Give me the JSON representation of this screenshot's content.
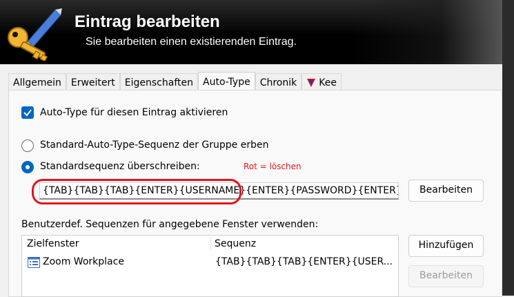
{
  "header": {
    "title": "Eintrag bearbeiten",
    "subtitle": "Sie bearbeiten einen existierenden Eintrag."
  },
  "tabs": [
    {
      "label": "Allgemein",
      "active": false
    },
    {
      "label": "Erweitert",
      "active": false
    },
    {
      "label": "Eigenschaften",
      "active": false
    },
    {
      "label": "Auto-Type",
      "active": true
    },
    {
      "label": "Chronik",
      "active": false
    },
    {
      "label": "Kee",
      "active": false
    }
  ],
  "autotype": {
    "enable_label": "Auto-Type für diesen Eintrag aktivieren",
    "enable_checked": true,
    "inherit_label": "Standard-Auto-Type-Sequenz der Gruppe erben",
    "override_label": "Standardsequenz überschreiben:",
    "override_selected": true,
    "sequence_value": "{TAB}{TAB}{TAB}{ENTER}{USERNAME}{ENTER}{PASSWORD}{ENTER}",
    "edit_button": "Bearbeiten",
    "annotation": "Rot = löschen"
  },
  "custom": {
    "label": "Benutzerdef. Sequenzen für angegebene Fenster verwenden:",
    "columns": [
      "Zielfenster",
      "Sequenz"
    ],
    "rows": [
      {
        "window": "Zoom Workplace",
        "sequence": "{TAB}{TAB}{TAB}{ENTER}{USER..."
      }
    ],
    "add_button": "Hinzufügen",
    "edit_button": "Bearbeiten"
  },
  "colors": {
    "accent": "#0067c0",
    "annotation": "#e0141a"
  },
  "icons": {
    "header": "key-pen-icon",
    "checkbox": "checkmark-icon",
    "kee_tab": "kee-icon",
    "row": "window-list-icon"
  }
}
